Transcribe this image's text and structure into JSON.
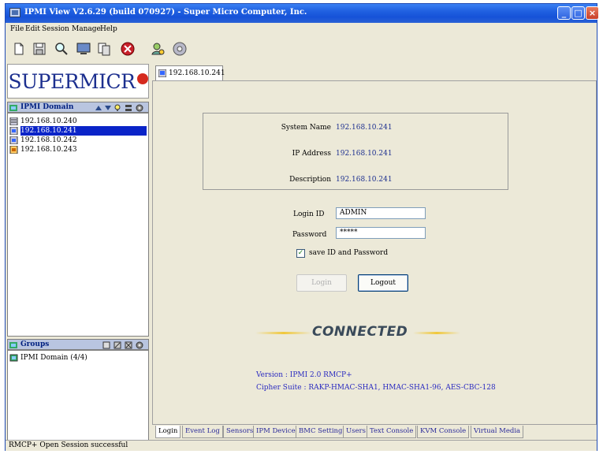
{
  "window": {
    "title": "IPMI View V2.6.29 (build 070927) - Super Micro Computer, Inc.",
    "controls": [
      "_",
      "□",
      "×"
    ]
  },
  "menu": [
    "File",
    "Edit",
    "Session",
    "Manage",
    "Help"
  ],
  "toolbar": {
    "icons": [
      "new-file-icon",
      "save-icon",
      "search-icon",
      "monitor-icon",
      "copy-icon",
      "stop-icon",
      "user-icon",
      "disk-icon"
    ]
  },
  "logo": {
    "text": "SUPERMICR",
    "dot_color": "#d52a1e",
    "text_color": "#1c2f8f"
  },
  "domain": {
    "header": "IPMI Domain",
    "hosts": [
      {
        "label": "192.168.10.240",
        "selected": false
      },
      {
        "label": "192.168.10.241",
        "selected": true
      },
      {
        "label": "192.168.10.242",
        "selected": false
      },
      {
        "label": "192.168.10.243",
        "selected": false
      }
    ]
  },
  "groups": {
    "header": "Groups",
    "items": [
      "IPMI Domain (4/4)"
    ]
  },
  "session_tab": {
    "label": "192.168.10.241"
  },
  "info": {
    "system_name_label": "System Name",
    "system_name": "192.168.10.241",
    "ip_address_label": "IP Address",
    "ip_address": "192.168.10.241",
    "description_label": "Description",
    "description": "192.168.10.241"
  },
  "login": {
    "login_id_label": "Login ID",
    "login_id": "ADMIN",
    "password_label": "Password",
    "password": "*****",
    "save_label": "save ID and Password",
    "save_checked": true,
    "login_button": "Login",
    "logout_button": "Logout"
  },
  "status": {
    "connected": "CONNECTED",
    "version": "Version : IPMI 2.0 RMCP+",
    "cipher": "Cipher Suite : RAKP-HMAC-SHA1, HMAC-SHA1-96, AES-CBC-128"
  },
  "bottom_tabs": [
    "Login",
    "Event Log",
    "Sensors",
    "IPM Device",
    "BMC Setting",
    "Users",
    "Text Console",
    "KVM Console",
    "Virtual Media"
  ],
  "statusbar": "RMCP+ Open Session successful"
}
